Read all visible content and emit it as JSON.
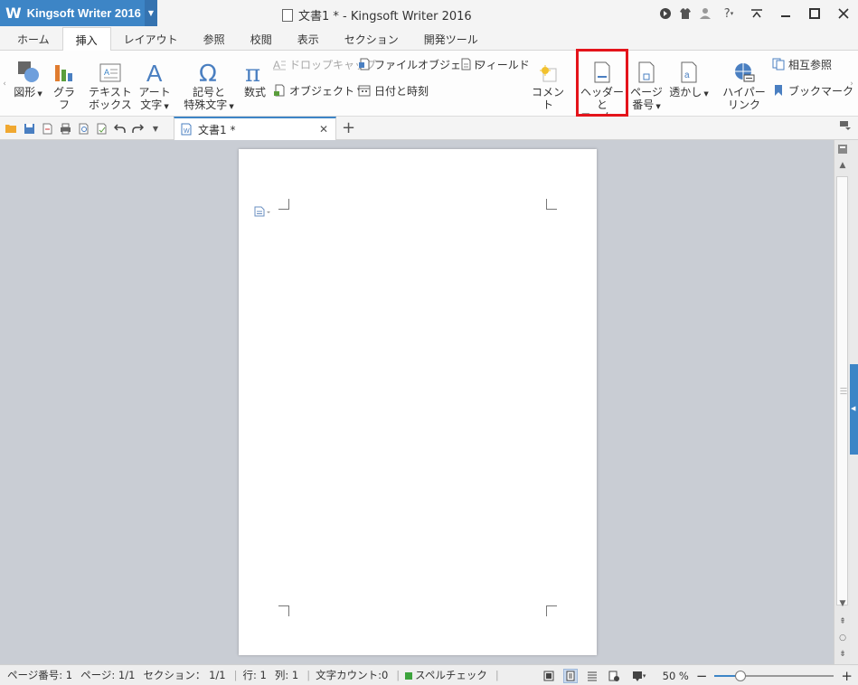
{
  "titlebar": {
    "app_name": "Kingsoft Writer 2016",
    "logo": "W",
    "doc_title": "文書1 * - Kingsoft Writer 2016"
  },
  "tabs": [
    "ホーム",
    "挿入",
    "レイアウト",
    "参照",
    "校閲",
    "表示",
    "セクション",
    "開発ツール"
  ],
  "active_tab": "挿入",
  "ribbon": {
    "shapes": "図形",
    "chart": "グラフ",
    "textbox_1": "テキスト",
    "textbox_2": "ボックス",
    "art_1": "アート",
    "art_2": "文字",
    "symbol_1": "記号と",
    "symbol_2": "特殊文字",
    "equation": "数式",
    "dropcap": "ドロップキャップ",
    "file_object": "ファイルオブジェクト",
    "field": "フィールド",
    "object": "オブジェクト",
    "datetime": "日付と時刻",
    "comment": "コメント",
    "header_footer_1": "ヘッダーと",
    "header_footer_2": "フッター",
    "page_number_1": "ページ",
    "page_number_2": "番号",
    "watermark": "透かし",
    "hyperlink_1": "ハイパー",
    "hyperlink_2": "リンク",
    "cross_ref": "相互参照",
    "bookmark": "ブックマーク"
  },
  "document_tab": {
    "label": "文書1 *"
  },
  "status": {
    "page_number": "ページ番号: 1",
    "page": "ページ: 1/1",
    "section": "セクション： 1/1",
    "row": "行: 1",
    "col": "列: 1",
    "word_count": "文字カウント:0",
    "spell_check": "スペルチェック",
    "zoom": "50 %",
    "zoom_fraction": 0.22
  },
  "colors": {
    "accent": "#3d85c6",
    "highlight": "#e4141b"
  }
}
